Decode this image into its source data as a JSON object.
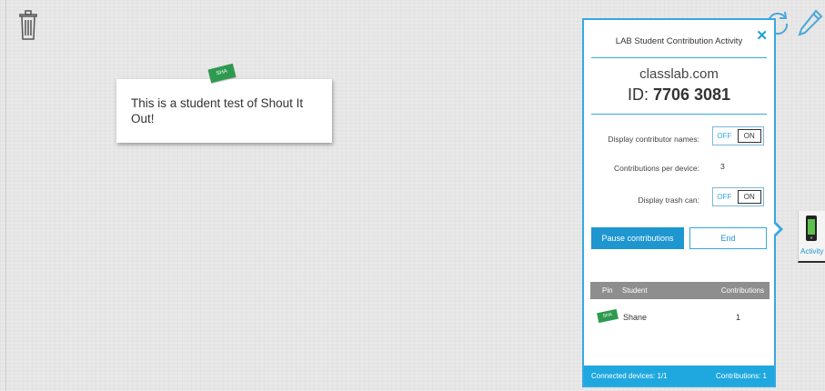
{
  "board": {
    "note_text": "This is a student test of Shout It Out!",
    "note_pin_label": "SHA",
    "trash_icon": "trash-icon",
    "refresh_icon": "refresh-icon",
    "pencil_icon": "pencil-icon"
  },
  "panel": {
    "title": "LAB Student Contribution Activity",
    "close_label": "✕",
    "domain": "classlab.com",
    "id_prefix": "ID:",
    "id_value": "7706 3081",
    "display_names_label": "Display contributor names:",
    "contributions_per_device_label": "Contributions per device:",
    "contributions_per_device_value": "3",
    "display_trash_label": "Display trash can:",
    "toggle_off_label": "OFF",
    "toggle_on_label": "ON",
    "pause_button_label": "Pause contributions",
    "end_button_label": "End",
    "table": {
      "headers": [
        "Pin",
        "Student",
        "Contributions"
      ],
      "rows": [
        {
          "pin": "SHA",
          "student": "Shane",
          "contributions": "1"
        }
      ]
    },
    "footer": {
      "connected": "Connected devices: 1/1",
      "contributions": "Contributions: 1"
    }
  },
  "activity_tab": {
    "label": "Activity",
    "icon": "phone-icon"
  },
  "colors": {
    "accent": "#36a9e1",
    "button_blue": "#1e96d0",
    "pin_green": "#2d9a4f",
    "table_header": "#8e8e8e"
  }
}
